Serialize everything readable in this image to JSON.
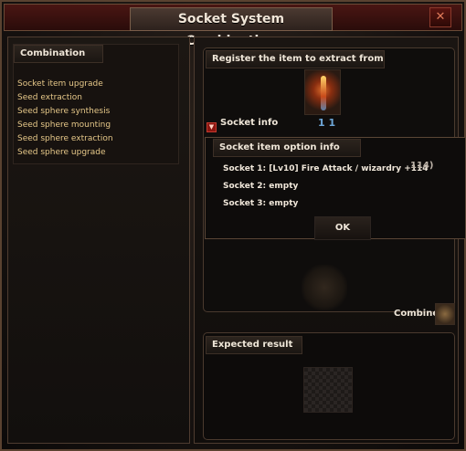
{
  "window": {
    "title": "Socket System Combination",
    "close_icon": "close-x-icon"
  },
  "left_panel": {
    "section_label": "Combination",
    "menu_items": [
      "Socket item upgrade",
      "Seed extraction",
      "Seed sphere synthesis",
      "Seed sphere mounting",
      "Seed sphere extraction",
      "Seed sphere upgrade"
    ]
  },
  "register_panel": {
    "label": "Register the item to extract from",
    "item_level_text": "1 1",
    "socket_info_label": "Socket info"
  },
  "popup": {
    "title": "Socket item option info",
    "lines": [
      "Socket 1: [Lv10] Fire  Attack / wizardry +114",
      "Socket 2: empty",
      "Socket 3: empty"
    ],
    "overflow_text": "114)",
    "ok_label": "OK"
  },
  "combine": {
    "label": "Combine"
  },
  "result_panel": {
    "label": "Expected result"
  },
  "colors": {
    "menu_text": "#e6c889",
    "title_bar": "#4a1613",
    "item_level": "#6ea7d8"
  }
}
